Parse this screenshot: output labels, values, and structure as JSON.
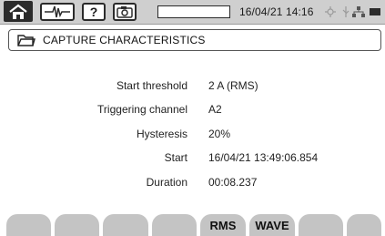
{
  "statusbar": {
    "icons": [
      "home-icon",
      "waveform-icon",
      "help-icon",
      "camera-icon"
    ],
    "help_label": "?",
    "progress": 0.0,
    "datetime": "16/04/21 14:16",
    "battery_icon": "battery-icon"
  },
  "title": "CAPTURE CHARACTERISTICS",
  "rows": [
    {
      "label": "Start threshold",
      "value": "2 A (RMS)"
    },
    {
      "label": "Triggering channel",
      "value": "A2"
    },
    {
      "label": "Hysteresis",
      "value": "20%"
    },
    {
      "label": "Start",
      "value": "16/04/21  13:49:06.854"
    },
    {
      "label": "Duration",
      "value": "00:08.237"
    }
  ],
  "softkeys": [
    "",
    "",
    "",
    "",
    "RMS",
    "WAVE",
    "",
    ""
  ]
}
